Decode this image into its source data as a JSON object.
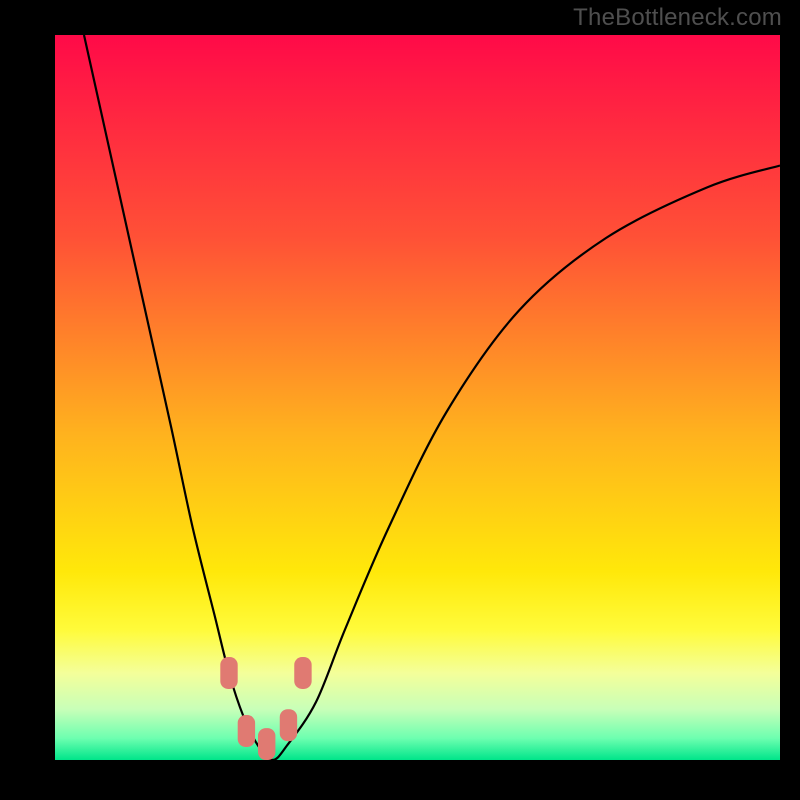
{
  "watermark": "TheBottleneck.com",
  "chart_data": {
    "type": "line",
    "title": "",
    "xlabel": "",
    "ylabel": "",
    "xlim": [
      0,
      100
    ],
    "ylim": [
      0,
      100
    ],
    "grid": false,
    "legend": false,
    "gradient_stops": [
      {
        "offset": 0,
        "color": "#ff0a48"
      },
      {
        "offset": 28,
        "color": "#ff5136"
      },
      {
        "offset": 55,
        "color": "#ffb21e"
      },
      {
        "offset": 74,
        "color": "#ffe80a"
      },
      {
        "offset": 82,
        "color": "#fffb3a"
      },
      {
        "offset": 88,
        "color": "#f4ff9a"
      },
      {
        "offset": 93,
        "color": "#c8ffb8"
      },
      {
        "offset": 97,
        "color": "#6dffb0"
      },
      {
        "offset": 100,
        "color": "#00e58a"
      }
    ],
    "series": [
      {
        "name": "bottleneck-curve",
        "color": "#000000",
        "x": [
          4,
          8,
          12,
          16,
          19,
          22,
          24,
          26,
          28,
          30,
          32,
          36,
          40,
          46,
          54,
          64,
          76,
          90,
          100
        ],
        "y": [
          100,
          82,
          64,
          46,
          32,
          20,
          12,
          6,
          2,
          0,
          2,
          8,
          18,
          32,
          48,
          62,
          72,
          79,
          82
        ]
      }
    ],
    "markers": [
      {
        "shape": "rounded-rect",
        "color": "#e07a72",
        "x": 24.0,
        "y": 12.0,
        "w": 2.4,
        "h": 4.4
      },
      {
        "shape": "rounded-rect",
        "color": "#e07a72",
        "x": 26.4,
        "y": 4.0,
        "w": 2.4,
        "h": 4.4
      },
      {
        "shape": "rounded-rect",
        "color": "#e07a72",
        "x": 29.2,
        "y": 2.2,
        "w": 2.4,
        "h": 4.4
      },
      {
        "shape": "rounded-rect",
        "color": "#e07a72",
        "x": 32.2,
        "y": 4.8,
        "w": 2.4,
        "h": 4.4
      },
      {
        "shape": "rounded-rect",
        "color": "#e07a72",
        "x": 34.2,
        "y": 12.0,
        "w": 2.4,
        "h": 4.4
      }
    ]
  }
}
